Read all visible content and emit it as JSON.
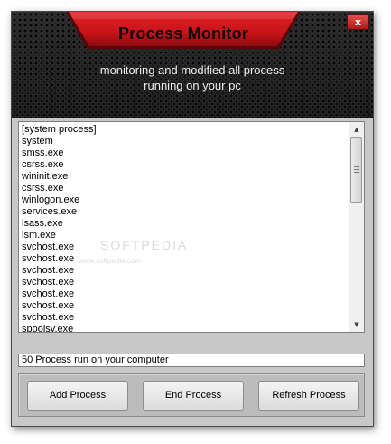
{
  "window": {
    "title": "Process Monitor",
    "subtitle_line1": "monitoring and modified all process",
    "subtitle_line2": "running on your pc",
    "close_label": "x"
  },
  "colors": {
    "banner_red": "#c8141a",
    "banner_dark_red": "#7a0a0c",
    "header_dark": "#1c1c1c",
    "panel_gray": "#c8c8c8"
  },
  "process_list": {
    "items": [
      "[system process]",
      "system",
      "smss.exe",
      "csrss.exe",
      "wininit.exe",
      "csrss.exe",
      "winlogon.exe",
      "services.exe",
      "lsass.exe",
      "lsm.exe",
      "svchost.exe",
      "svchost.exe",
      "svchost.exe",
      "svchost.exe",
      "svchost.exe",
      "svchost.exe",
      "svchost.exe",
      "spoolsv.exe"
    ]
  },
  "watermark": {
    "text": "SOFTPEDIA",
    "url": "www.softpedia.com"
  },
  "status": {
    "text": "50 Process run on your computer"
  },
  "buttons": {
    "add": "Add Process",
    "end": "End Process",
    "refresh": "Refresh Process"
  },
  "icons": {
    "close": "close-icon",
    "scroll_up": "scroll-up-arrow-icon",
    "scroll_down": "scroll-down-arrow-icon",
    "grip": "scroll-grip-icon"
  }
}
